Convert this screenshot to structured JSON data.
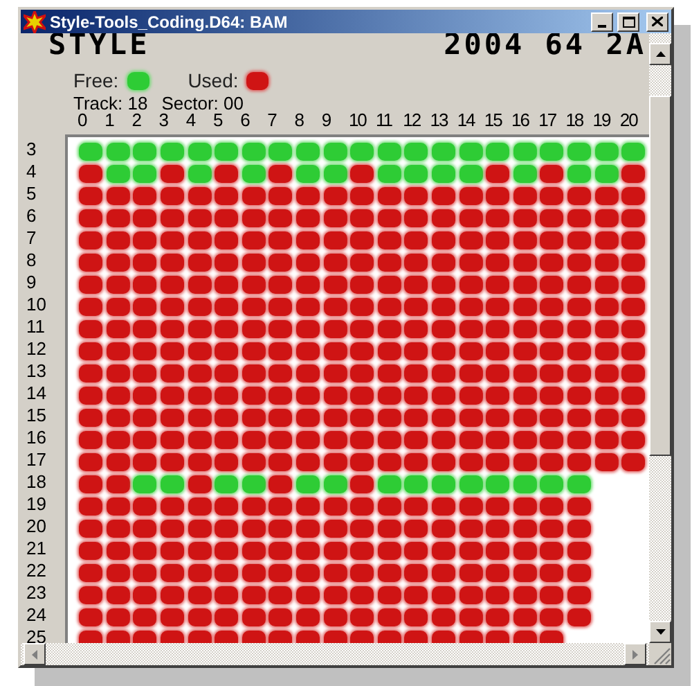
{
  "window": {
    "title": "Style-Tools_Coding.D64: BAM"
  },
  "disk": {
    "name": "STYLE",
    "id": "2004 64 2A"
  },
  "legend": [
    {
      "label": "Free:",
      "kind": "free"
    },
    {
      "label": "Used:",
      "kind": "used"
    }
  ],
  "position": {
    "track": "Track: 18",
    "sector": "Sector: 00"
  },
  "sector_columns": [
    "0",
    "1",
    "2",
    "3",
    "4",
    "5",
    "6",
    "7",
    "8",
    "9",
    "10",
    "11",
    "12",
    "13",
    "14",
    "15",
    "16",
    "17",
    "18",
    "19",
    "20"
  ],
  "tracks": [
    {
      "label": "3",
      "sectors": [
        true,
        true,
        true,
        true,
        true,
        true,
        true,
        true,
        true,
        true,
        true,
        true,
        true,
        true,
        true,
        true,
        true,
        true,
        true,
        true,
        true
      ]
    },
    {
      "label": "4",
      "sectors": [
        false,
        true,
        true,
        false,
        true,
        false,
        true,
        false,
        true,
        true,
        false,
        true,
        true,
        true,
        true,
        false,
        true,
        false,
        true,
        true,
        false
      ]
    },
    {
      "label": "5",
      "sectors": [
        false,
        false,
        false,
        false,
        false,
        false,
        false,
        false,
        false,
        false,
        false,
        false,
        false,
        false,
        false,
        false,
        false,
        false,
        false,
        false,
        false
      ]
    },
    {
      "label": "6",
      "sectors": [
        false,
        false,
        false,
        false,
        false,
        false,
        false,
        false,
        false,
        false,
        false,
        false,
        false,
        false,
        false,
        false,
        false,
        false,
        false,
        false,
        false
      ]
    },
    {
      "label": "7",
      "sectors": [
        false,
        false,
        false,
        false,
        false,
        false,
        false,
        false,
        false,
        false,
        false,
        false,
        false,
        false,
        false,
        false,
        false,
        false,
        false,
        false,
        false
      ]
    },
    {
      "label": "8",
      "sectors": [
        false,
        false,
        false,
        false,
        false,
        false,
        false,
        false,
        false,
        false,
        false,
        false,
        false,
        false,
        false,
        false,
        false,
        false,
        false,
        false,
        false
      ]
    },
    {
      "label": "9",
      "sectors": [
        false,
        false,
        false,
        false,
        false,
        false,
        false,
        false,
        false,
        false,
        false,
        false,
        false,
        false,
        false,
        false,
        false,
        false,
        false,
        false,
        false
      ]
    },
    {
      "label": "10",
      "sectors": [
        false,
        false,
        false,
        false,
        false,
        false,
        false,
        false,
        false,
        false,
        false,
        false,
        false,
        false,
        false,
        false,
        false,
        false,
        false,
        false,
        false
      ]
    },
    {
      "label": "11",
      "sectors": [
        false,
        false,
        false,
        false,
        false,
        false,
        false,
        false,
        false,
        false,
        false,
        false,
        false,
        false,
        false,
        false,
        false,
        false,
        false,
        false,
        false
      ]
    },
    {
      "label": "12",
      "sectors": [
        false,
        false,
        false,
        false,
        false,
        false,
        false,
        false,
        false,
        false,
        false,
        false,
        false,
        false,
        false,
        false,
        false,
        false,
        false,
        false,
        false
      ]
    },
    {
      "label": "13",
      "sectors": [
        false,
        false,
        false,
        false,
        false,
        false,
        false,
        false,
        false,
        false,
        false,
        false,
        false,
        false,
        false,
        false,
        false,
        false,
        false,
        false,
        false
      ]
    },
    {
      "label": "14",
      "sectors": [
        false,
        false,
        false,
        false,
        false,
        false,
        false,
        false,
        false,
        false,
        false,
        false,
        false,
        false,
        false,
        false,
        false,
        false,
        false,
        false,
        false
      ]
    },
    {
      "label": "15",
      "sectors": [
        false,
        false,
        false,
        false,
        false,
        false,
        false,
        false,
        false,
        false,
        false,
        false,
        false,
        false,
        false,
        false,
        false,
        false,
        false,
        false,
        false
      ]
    },
    {
      "label": "16",
      "sectors": [
        false,
        false,
        false,
        false,
        false,
        false,
        false,
        false,
        false,
        false,
        false,
        false,
        false,
        false,
        false,
        false,
        false,
        false,
        false,
        false,
        false
      ]
    },
    {
      "label": "17",
      "sectors": [
        false,
        false,
        false,
        false,
        false,
        false,
        false,
        false,
        false,
        false,
        false,
        false,
        false,
        false,
        false,
        false,
        false,
        false,
        false,
        false,
        false
      ]
    },
    {
      "label": "18",
      "sectors": [
        false,
        false,
        true,
        true,
        false,
        true,
        true,
        false,
        true,
        true,
        false,
        true,
        true,
        true,
        true,
        true,
        true,
        true,
        true
      ]
    },
    {
      "label": "19",
      "sectors": [
        false,
        false,
        false,
        false,
        false,
        false,
        false,
        false,
        false,
        false,
        false,
        false,
        false,
        false,
        false,
        false,
        false,
        false,
        false
      ]
    },
    {
      "label": "20",
      "sectors": [
        false,
        false,
        false,
        false,
        false,
        false,
        false,
        false,
        false,
        false,
        false,
        false,
        false,
        false,
        false,
        false,
        false,
        false,
        false
      ]
    },
    {
      "label": "21",
      "sectors": [
        false,
        false,
        false,
        false,
        false,
        false,
        false,
        false,
        false,
        false,
        false,
        false,
        false,
        false,
        false,
        false,
        false,
        false,
        false
      ]
    },
    {
      "label": "22",
      "sectors": [
        false,
        false,
        false,
        false,
        false,
        false,
        false,
        false,
        false,
        false,
        false,
        false,
        false,
        false,
        false,
        false,
        false,
        false,
        false
      ]
    },
    {
      "label": "23",
      "sectors": [
        false,
        false,
        false,
        false,
        false,
        false,
        false,
        false,
        false,
        false,
        false,
        false,
        false,
        false,
        false,
        false,
        false,
        false,
        false
      ]
    },
    {
      "label": "24",
      "sectors": [
        false,
        false,
        false,
        false,
        false,
        false,
        false,
        false,
        false,
        false,
        false,
        false,
        false,
        false,
        false,
        false,
        false,
        false,
        false
      ]
    },
    {
      "label": "25",
      "sectors": [
        false,
        false,
        false,
        false,
        false,
        false,
        false,
        false,
        false,
        false,
        false,
        false,
        false,
        false,
        false,
        false,
        false,
        false
      ]
    }
  ]
}
